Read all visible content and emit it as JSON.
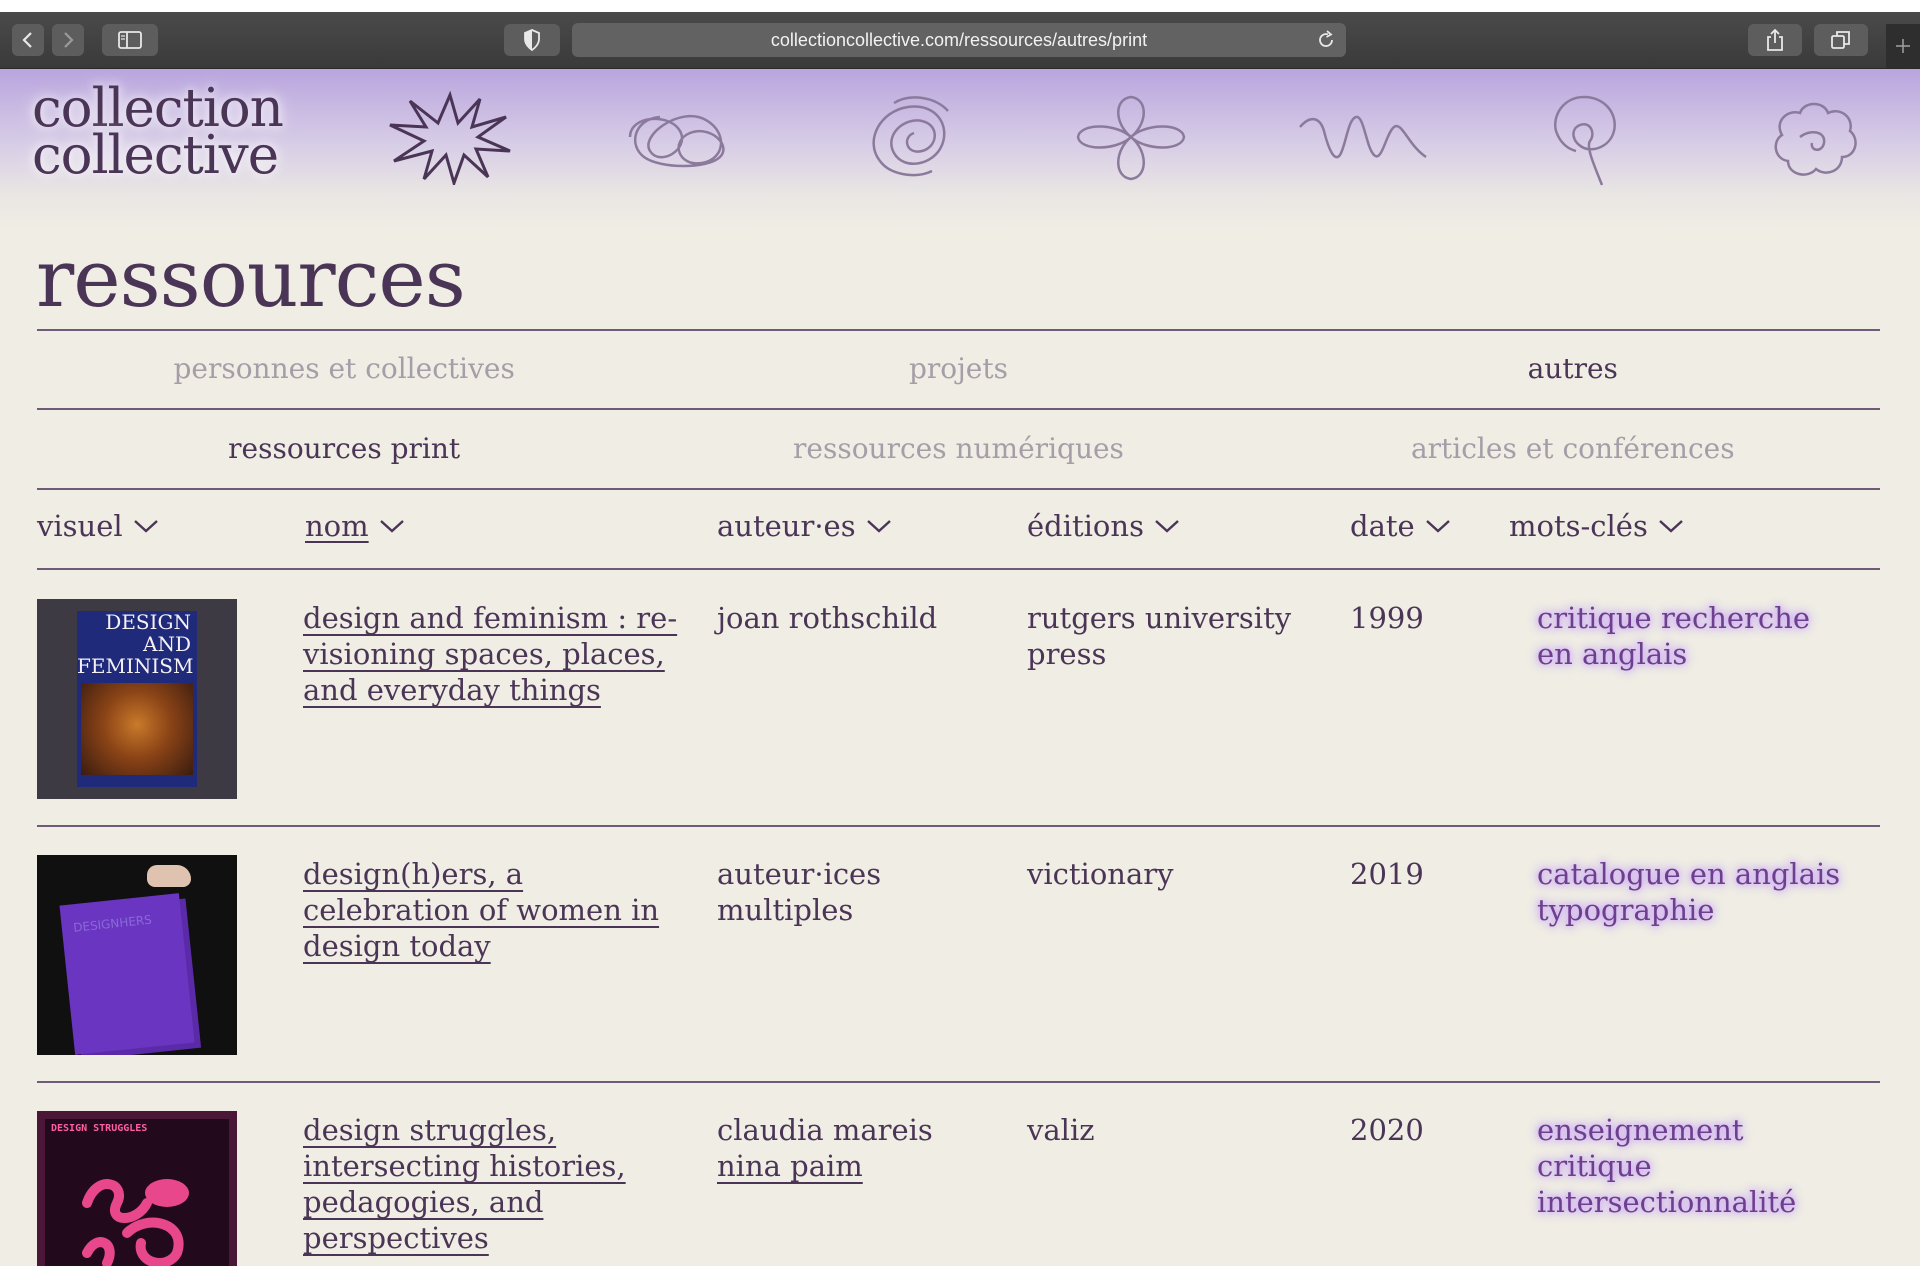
{
  "browser": {
    "url": "collectioncollective.com/ressources/autres/print",
    "icons": [
      "back-icon",
      "forward-icon",
      "sidebar-icon",
      "privacy-shield-icon",
      "reload-icon",
      "share-icon",
      "tabs-icon",
      "new-tab-icon"
    ]
  },
  "site": {
    "logo_line1": "collection",
    "logo_line2": "collective",
    "decorations": [
      "starburst-icon",
      "loop-scribble-icon",
      "spiral-icon",
      "flower-icon",
      "zigzag-icon",
      "lollipop-scribble-icon",
      "cloud-scribble-icon"
    ]
  },
  "page_title": "ressources",
  "nav_primary": [
    {
      "label": "personnes et collectives",
      "active": false
    },
    {
      "label": "projets",
      "active": false
    },
    {
      "label": "autres",
      "active": true
    }
  ],
  "nav_secondary": [
    {
      "label": "ressources print",
      "active": true
    },
    {
      "label": "ressources numériques",
      "active": false
    },
    {
      "label": "articles et conférences",
      "active": false
    }
  ],
  "columns": [
    "visuel",
    "nom",
    "auteur·es",
    "éditions",
    "date",
    "mots-clés"
  ],
  "rows": [
    {
      "title": "design and feminism : re-visioning spaces, places, and everyday things",
      "authors": "joan rothschild",
      "edition": "rutgers university press",
      "date": "1999",
      "tags": [
        "critique",
        "recherche",
        "en anglais"
      ],
      "cover_text": [
        "DESIGN",
        "AND",
        "FEMINISM"
      ]
    },
    {
      "title": "design(h)ers, a celebration of women in design today",
      "authors": "auteur·ices multiples",
      "edition": "victionary",
      "date": "2019",
      "tags": [
        "catalogue",
        "en anglais",
        "typographie"
      ],
      "cover_text": [
        "DESIGNHERS"
      ]
    },
    {
      "title": "design struggles, intersecting histories, pedagogies, and perspectives",
      "authors_list": [
        "claudia mareis",
        "nina paim"
      ],
      "edition": "valiz",
      "date": "2020",
      "tags": [
        "enseignement",
        "critique",
        "intersectionnalité"
      ],
      "cover_text": [
        "DESIGN STRUGGLES"
      ]
    }
  ],
  "colors": {
    "ink": "#4b3556",
    "muted": "#a59ea8",
    "background": "#efede4",
    "header_lavender": "#b9a5de",
    "tag_glow": "#c9a8f3"
  }
}
